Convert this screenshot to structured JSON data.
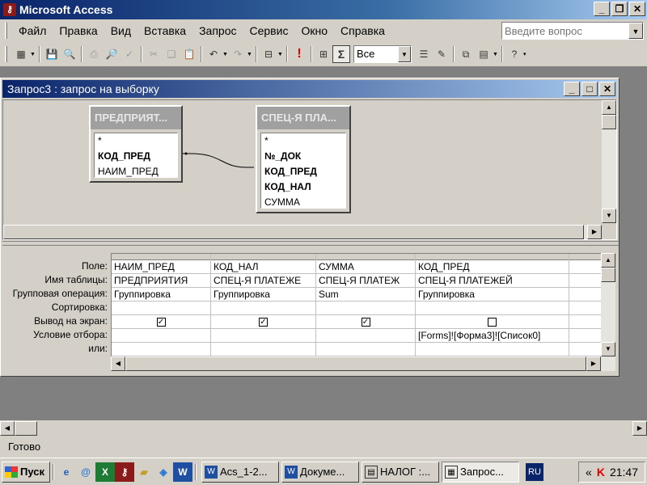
{
  "app": {
    "title": "Microsoft Access"
  },
  "menu": {
    "items": [
      "Файл",
      "Правка",
      "Вид",
      "Вставка",
      "Запрос",
      "Сервис",
      "Окно",
      "Справка"
    ],
    "help_placeholder": "Введите вопрос"
  },
  "toolbar": {
    "total_value": "Все",
    "sigma": "Σ",
    "icons": [
      "view-icon",
      "save-icon",
      "search-file-icon",
      "print-icon",
      "print-preview-icon",
      "spelling-icon",
      "cut-icon",
      "copy-icon",
      "paste-icon",
      "undo-icon",
      "redo-icon",
      "query-type-icon",
      "run-icon",
      "show-table-icon",
      "totals-icon",
      "properties-icon",
      "build-icon",
      "database-window-icon",
      "new-object-icon",
      "help-icon"
    ]
  },
  "query_window": {
    "title": "Запрос3 : запрос на выборку",
    "tables": [
      {
        "name": "ПРЕДПРИЯТ...",
        "fields": [
          {
            "name": "*",
            "key": false
          },
          {
            "name": "КОД_ПРЕД",
            "key": true
          },
          {
            "name": "НАИМ_ПРЕД",
            "key": false
          }
        ]
      },
      {
        "name": "СПЕЦ-Я ПЛА...",
        "fields": [
          {
            "name": "*",
            "key": false
          },
          {
            "name": "№_ДОК",
            "key": true
          },
          {
            "name": "КОД_ПРЕД",
            "key": true
          },
          {
            "name": "КОД_НАЛ",
            "key": true
          },
          {
            "name": "СУММА",
            "key": false
          }
        ]
      }
    ],
    "row_labels": [
      "Поле:",
      "Имя таблицы:",
      "Групповая операция:",
      "Сортировка:",
      "Вывод на экран:",
      "Условие отбора:",
      "или:"
    ],
    "columns": [
      {
        "field": "НАИМ_ПРЕД",
        "table": "ПРЕДПРИЯТИЯ",
        "total": "Группировка",
        "sort": "",
        "show": true,
        "criteria": "",
        "or": ""
      },
      {
        "field": "КОД_НАЛ",
        "table": "СПЕЦ-Я ПЛАТЕЖЕ",
        "total": "Группировка",
        "sort": "",
        "show": true,
        "criteria": "",
        "or": ""
      },
      {
        "field": "СУММА",
        "table": "СПЕЦ-Я ПЛАТЕЖ",
        "total": "Sum",
        "sort": "",
        "show": true,
        "criteria": "",
        "or": ""
      },
      {
        "field": "КОД_ПРЕД",
        "table": "СПЕЦ-Я ПЛАТЕЖЕЙ",
        "total": "Группировка",
        "sort": "",
        "show": false,
        "criteria": "[Forms]![Форма3]![Список0]",
        "or": ""
      },
      {
        "field": "",
        "table": "",
        "total": "",
        "sort": "",
        "show": null,
        "criteria": "",
        "or": ""
      }
    ]
  },
  "status": {
    "text": "Готово"
  },
  "taskbar": {
    "start_label": "Пуск",
    "quick_launch": [
      "ie-icon",
      "outlook-express-icon",
      "excel-icon",
      "access-icon",
      "folder-icon",
      "media-icon",
      "word-icon"
    ],
    "tasks": [
      {
        "label": "Acs_1-2...",
        "icon": "word-doc-icon",
        "active": false
      },
      {
        "label": "Докуме...",
        "icon": "word-doc-icon",
        "active": false
      },
      {
        "label": "НАЛОГ :...",
        "icon": "database-icon",
        "active": false
      },
      {
        "label": "Запрос...",
        "icon": "query-icon",
        "active": true
      }
    ],
    "language": "RU",
    "clock": "21:47"
  }
}
